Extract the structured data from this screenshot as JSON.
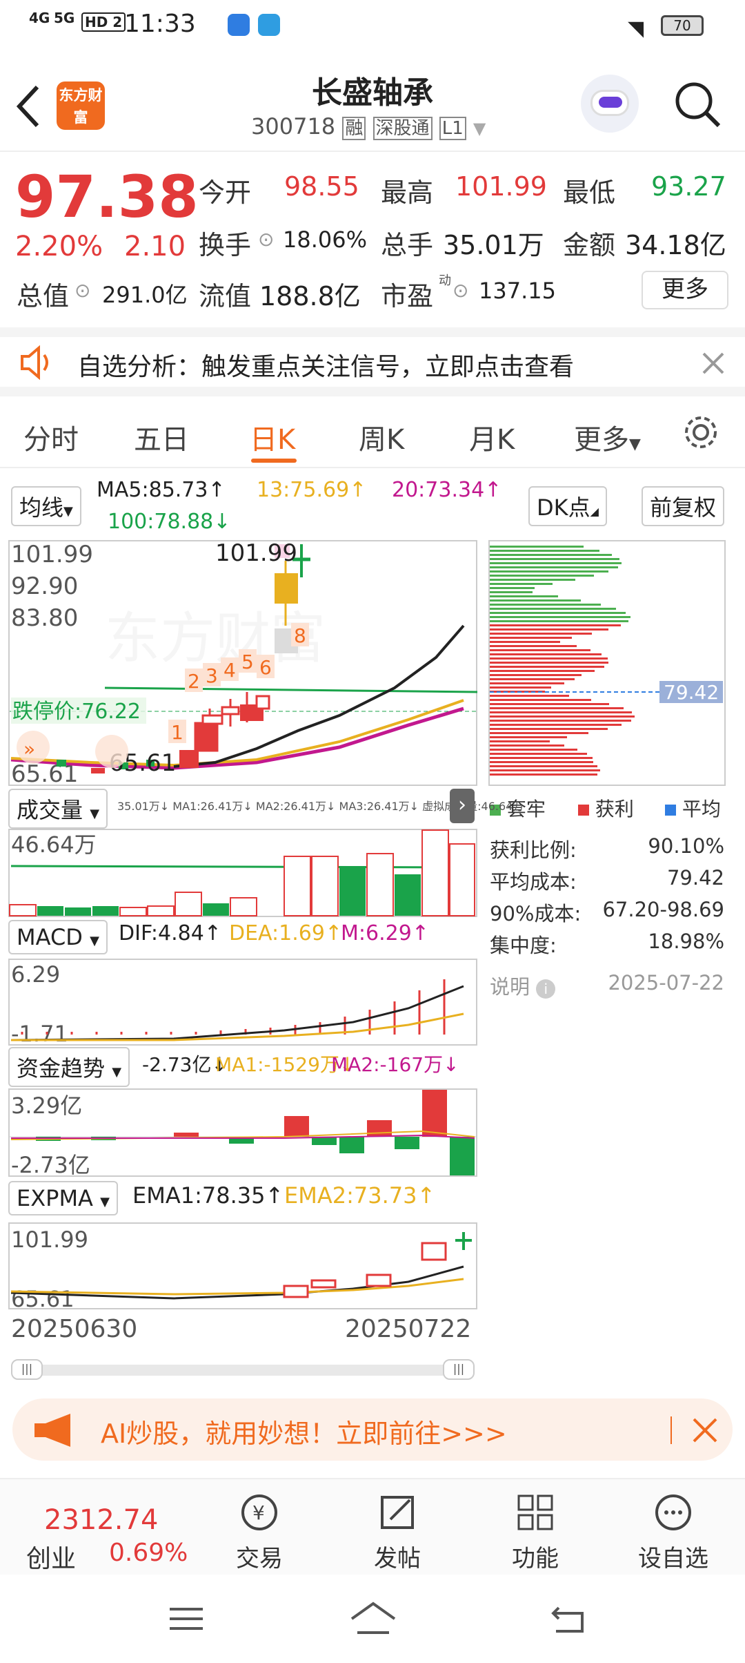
{
  "status": {
    "time": "11:33",
    "signal_left": "4G",
    "signal_right": "5G",
    "hd": "HD 2",
    "battery": "70"
  },
  "header": {
    "title": "长盛轴承",
    "code": "300718",
    "tags": [
      "融",
      "深股通",
      "L1"
    ],
    "logo_text": "东方财富"
  },
  "quote": {
    "price": "97.38",
    "change_pct": "2.20%",
    "change": "2.10",
    "open_label": "今开",
    "open": "98.55",
    "high_label": "最高",
    "high": "101.99",
    "low_label": "最低",
    "low": "93.27",
    "turnover_label": "换手",
    "turnover": "18.06%",
    "volume_label": "总手",
    "volume": "35.01万",
    "amount_label": "金额",
    "amount": "34.18亿",
    "mktcap_label": "总值",
    "mktcap": "291.0亿",
    "float_label": "流值",
    "float": "188.8亿",
    "pe_label": "市盈",
    "pe_sup": "动",
    "pe": "137.15",
    "more": "更多"
  },
  "notice": {
    "text": "自选分析：触发重点关注信号，立即点击查看"
  },
  "tabs": [
    {
      "label": "分时"
    },
    {
      "label": "五日"
    },
    {
      "label": "日K"
    },
    {
      "label": "周K"
    },
    {
      "label": "月K"
    },
    {
      "label": "更多"
    }
  ],
  "kchart": {
    "ma_select": "均线",
    "ma5": "MA5:85.73↑",
    "ma13": "13:75.69↑",
    "ma20": "20:73.34↑",
    "ma100": "100:78.88↓",
    "dk": "DK点",
    "adjust": "前复权",
    "y_high": "101.99",
    "y_mid1": "92.90",
    "y_mid2": "83.80",
    "y_low": "65.61",
    "max_mark": "101.99",
    "min_mark": "65.61",
    "limit_down": "跌停价:76.22",
    "signal_nums": [
      "1",
      "2",
      "3",
      "4",
      "5",
      "6",
      "8"
    ],
    "cost_label": "79.42"
  },
  "volume_panel": {
    "select": "成交量",
    "stats": "35.01万↓ MA1:26.41万↓ MA2:26.41万↓ MA3:26.41万↓ 虚拟成交量:46.64万",
    "y_high": "46.64万"
  },
  "macd_panel": {
    "select": "MACD",
    "dif": "DIF:4.84↑",
    "dea": "DEA:1.69↑",
    "m": "M:6.29↑",
    "y_high": "6.29",
    "y_low": "-1.71"
  },
  "fund_panel": {
    "select": "资金趋势",
    "val": "-2.73亿↓",
    "ma1": "MA1:-1529万↓",
    "ma2": "MA2:-167万↓",
    "y_high": "3.29亿",
    "y_low": "-2.73亿"
  },
  "expma_panel": {
    "select": "EXPMA",
    "ema1": "EMA1:78.35↑",
    "ema2": "EMA2:73.73↑",
    "y_high": "101.99",
    "y_low": "65.61"
  },
  "dates": {
    "start": "20250630",
    "end": "20250722"
  },
  "chip": {
    "legend": [
      "套牢",
      "获利",
      "平均"
    ],
    "rows": [
      {
        "label": "获利比例:",
        "value": "90.10%"
      },
      {
        "label": "平均成本:",
        "value": "79.42"
      },
      {
        "label": "90%成本:",
        "value": "67.20-98.69"
      },
      {
        "label": "集中度:",
        "value": "18.98%"
      }
    ],
    "note_label": "说明",
    "date": "2025-07-22"
  },
  "ad": {
    "text": "AI炒股，就用妙想！立即前往>>>"
  },
  "bottom": {
    "index_value": "2312.74",
    "index_name": "创业",
    "index_pct": "0.69%",
    "trade": "交易",
    "post": "发帖",
    "func": "功能",
    "watch": "设自选"
  },
  "colors": {
    "up": "#e23a3a",
    "down": "#1aa34a",
    "accent": "#f06a1f"
  }
}
